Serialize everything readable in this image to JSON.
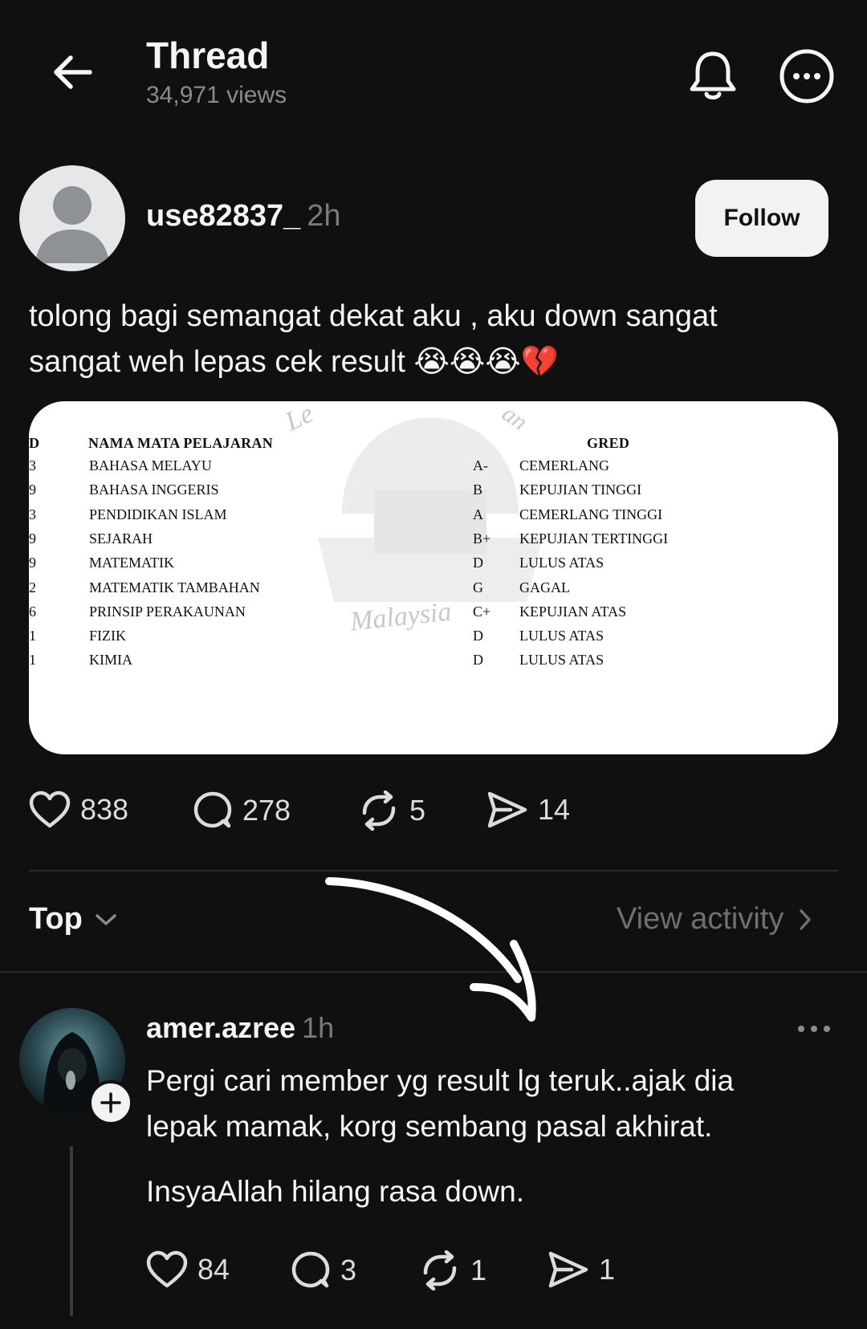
{
  "header": {
    "title": "Thread",
    "views": "34,971 views"
  },
  "post": {
    "username": "use82837_",
    "time": "2h",
    "follow_label": "Follow",
    "text_line1": "tolong bagi semangat dekat aku , aku down sangat",
    "text_line2": "sangat weh lepas cek result 😭😭😭💔",
    "likes": "838",
    "comments": "278",
    "reposts": "5",
    "shares": "14"
  },
  "result_sheet": {
    "header_code": "D",
    "header_subject": "NAMA MATA PELAJARAN",
    "header_grade": "GRED",
    "watermark_left": "Le",
    "watermark_right": "an",
    "watermark_bottom": "Malaysia",
    "rows": [
      {
        "code": "3",
        "subject": "BAHASA MELAYU",
        "grade": "A-",
        "desc": "CEMERLANG"
      },
      {
        "code": "9",
        "subject": "BAHASA INGGERIS",
        "grade": "B",
        "desc": "KEPUJIAN TINGGI"
      },
      {
        "code": "3",
        "subject": "PENDIDIKAN ISLAM",
        "grade": "A",
        "desc": "CEMERLANG TINGGI"
      },
      {
        "code": "9",
        "subject": "SEJARAH",
        "grade": "B+",
        "desc": "KEPUJIAN TERTINGGI"
      },
      {
        "code": "9",
        "subject": "MATEMATIK",
        "grade": "D",
        "desc": "LULUS ATAS"
      },
      {
        "code": "2",
        "subject": "MATEMATIK TAMBAHAN",
        "grade": "G",
        "desc": "GAGAL"
      },
      {
        "code": "6",
        "subject": "PRINSIP PERAKAUNAN",
        "grade": "C+",
        "desc": "KEPUJIAN ATAS"
      },
      {
        "code": "1",
        "subject": "FIZIK",
        "grade": "D",
        "desc": "LULUS ATAS"
      },
      {
        "code": "1",
        "subject": "KIMIA",
        "grade": "D",
        "desc": "LULUS ATAS"
      }
    ]
  },
  "sort": {
    "top_label": "Top",
    "view_activity": "View activity"
  },
  "reply": {
    "username": "amer.azree",
    "time": "1h",
    "text_line1": "Pergi cari member yg result lg teruk..ajak dia",
    "text_line2": "lepak mamak, korg sembang pasal akhirat.",
    "text_line3": "InsyaAllah hilang rasa down.",
    "likes": "84",
    "comments": "3",
    "reposts": "1",
    "shares": "1"
  },
  "icons": {
    "back": "arrow-left-icon",
    "bell": "bell-icon",
    "more": "more-circle-icon",
    "like": "heart-icon",
    "comment": "comment-icon",
    "repost": "repost-icon",
    "share": "send-icon"
  },
  "colors": {
    "background": "#101010",
    "text": "#f5f5f5",
    "muted": "#7a7a7a",
    "follow_bg": "#f2f2f2"
  }
}
